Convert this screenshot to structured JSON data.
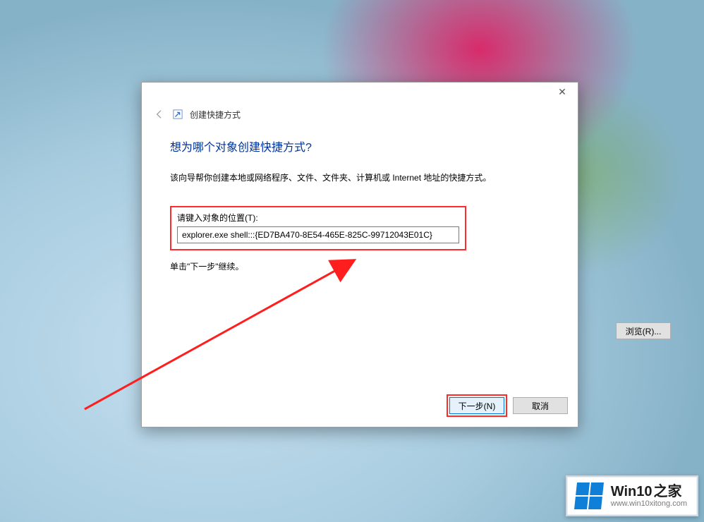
{
  "dialog": {
    "window_title": "创建快捷方式",
    "heading": "想为哪个对象创建快捷方式?",
    "description": "该向导帮你创建本地或网络程序、文件、文件夹、计算机或 Internet 地址的快捷方式。",
    "location_label": "请键入对象的位置(T):",
    "location_value": "explorer.exe shell:::{ED7BA470-8E54-465E-825C-99712043E01C}",
    "browse_label": "浏览(R)...",
    "hint": "单击\"下一步\"继续。",
    "next_label": "下一步(N)",
    "cancel_label": "取消"
  },
  "watermark": {
    "brand_en": "Win10",
    "brand_cn": "之家",
    "url": "www.win10xitong.com"
  },
  "colors": {
    "heading": "#003399",
    "highlight_border": "#ff2a2a",
    "primary_border": "#0078d7",
    "winlogo": "#0f7fd8"
  }
}
